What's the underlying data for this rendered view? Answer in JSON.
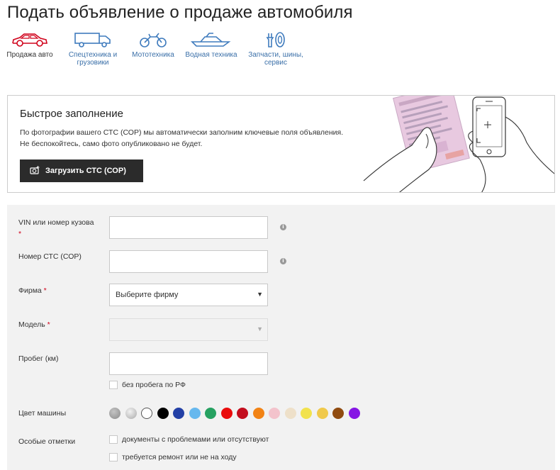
{
  "page": {
    "title": "Подать объявление о продаже автомобиля"
  },
  "categories": [
    {
      "label": "Продажа авто",
      "icon": "car-icon",
      "active": true
    },
    {
      "label": "Спецтехника и грузовики",
      "icon": "truck-icon",
      "active": false
    },
    {
      "label": "Мототехника",
      "icon": "motorcycle-icon",
      "active": false
    },
    {
      "label": "Водная техника",
      "icon": "boat-icon",
      "active": false
    },
    {
      "label": "Запчасти, шины, сервис",
      "icon": "tools-icon",
      "active": false
    }
  ],
  "quick_fill": {
    "title": "Быстрое заполнение",
    "desc_line1": "По фотографии вашего СТС (СОР) мы автоматически заполним ключевые поля объявления.",
    "desc_line2": "Не беспокойтесь, само фото опубликовано не будет.",
    "upload_label": "Загрузить СТС (СОР)",
    "upload_icon": "camera-plus-icon",
    "illustration": "hands-phone-document-illustration"
  },
  "form": {
    "vin_label": "VIN или номер кузова",
    "vin_required": "*",
    "vin_value": "",
    "sts_label": "Номер СТС (СОР)",
    "sts_value": "",
    "make_label": "Фирма",
    "make_required": "*",
    "make_value": "Выберите фирму",
    "model_label": "Модель",
    "model_required": "*",
    "model_value": "",
    "mileage_label": "Пробег (км)",
    "mileage_value": "",
    "no_mileage_label": "без пробега по РФ",
    "color_label": "Цвет машины",
    "notes_label": "Особые отметки",
    "note_docs": "документы с проблемами или отсутствуют",
    "note_repair": "требуется ремонт или не на ходу",
    "info_icon": "info-icon",
    "colors": [
      {
        "name": "gray",
        "hex": "#a5a5a5"
      },
      {
        "name": "silver",
        "hex": "#cfcfcf"
      },
      {
        "name": "white",
        "hex": "#ffffff"
      },
      {
        "name": "black",
        "hex": "#000000"
      },
      {
        "name": "dark-blue",
        "hex": "#2340a6"
      },
      {
        "name": "light-blue",
        "hex": "#67b8ee"
      },
      {
        "name": "green",
        "hex": "#26a161"
      },
      {
        "name": "red",
        "hex": "#ea0c0c"
      },
      {
        "name": "burgundy",
        "hex": "#c30e1e"
      },
      {
        "name": "orange",
        "hex": "#f28315"
      },
      {
        "name": "pink",
        "hex": "#f3c3cc"
      },
      {
        "name": "beige",
        "hex": "#eee0c9"
      },
      {
        "name": "yellow",
        "hex": "#f2e24d"
      },
      {
        "name": "gold",
        "hex": "#f0c94b"
      },
      {
        "name": "brown",
        "hex": "#904b10"
      },
      {
        "name": "purple",
        "hex": "#8616e4"
      }
    ]
  },
  "colors": {
    "link": "#3a6fa8",
    "icon": "#3f7bbd",
    "active_icon": "#d0021b",
    "button": "#2b2b2b",
    "panel": "#f2f2f2",
    "required": "#d0021b"
  }
}
